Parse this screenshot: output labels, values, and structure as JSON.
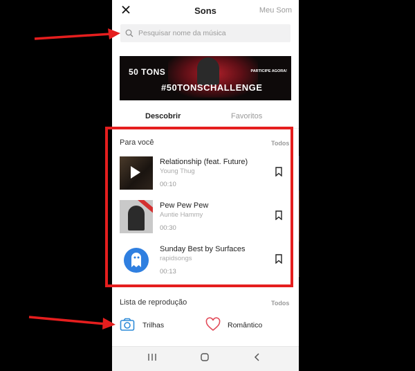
{
  "header": {
    "title": "Sons",
    "my_sound": "Meu Som"
  },
  "search": {
    "placeholder": "Pesquisar nome da música"
  },
  "banner": {
    "left_text": "50 TONS",
    "right_text": "PARTICIPE AGORA!",
    "hashtag": "#50TONSCHALLENGE"
  },
  "tabs": [
    {
      "label": "Descobrir",
      "active": true
    },
    {
      "label": "Favoritos",
      "active": false
    }
  ],
  "for_you": {
    "title": "Para você",
    "see_all": "Todos",
    "tracks": [
      {
        "title": "Relationship (feat. Future)",
        "artist": "Young Thug",
        "duration": "00:10"
      },
      {
        "title": "Pew Pew Pew",
        "artist": "Auntie Hammy",
        "duration": "00:30"
      },
      {
        "title": "Sunday Best by Surfaces",
        "artist": "rapidsongs",
        "duration": "00:13"
      }
    ]
  },
  "playlists": {
    "title": "Lista de reprodução",
    "see_all": "Todos",
    "items": [
      {
        "label": "Trilhas",
        "icon": "camera-icon"
      },
      {
        "label": "Romântico",
        "icon": "heart-icon"
      }
    ]
  },
  "colors": {
    "annotation_red": "#e51e1e",
    "accent_blue": "#2f8bd8",
    "heart_red": "#e24b5a"
  }
}
